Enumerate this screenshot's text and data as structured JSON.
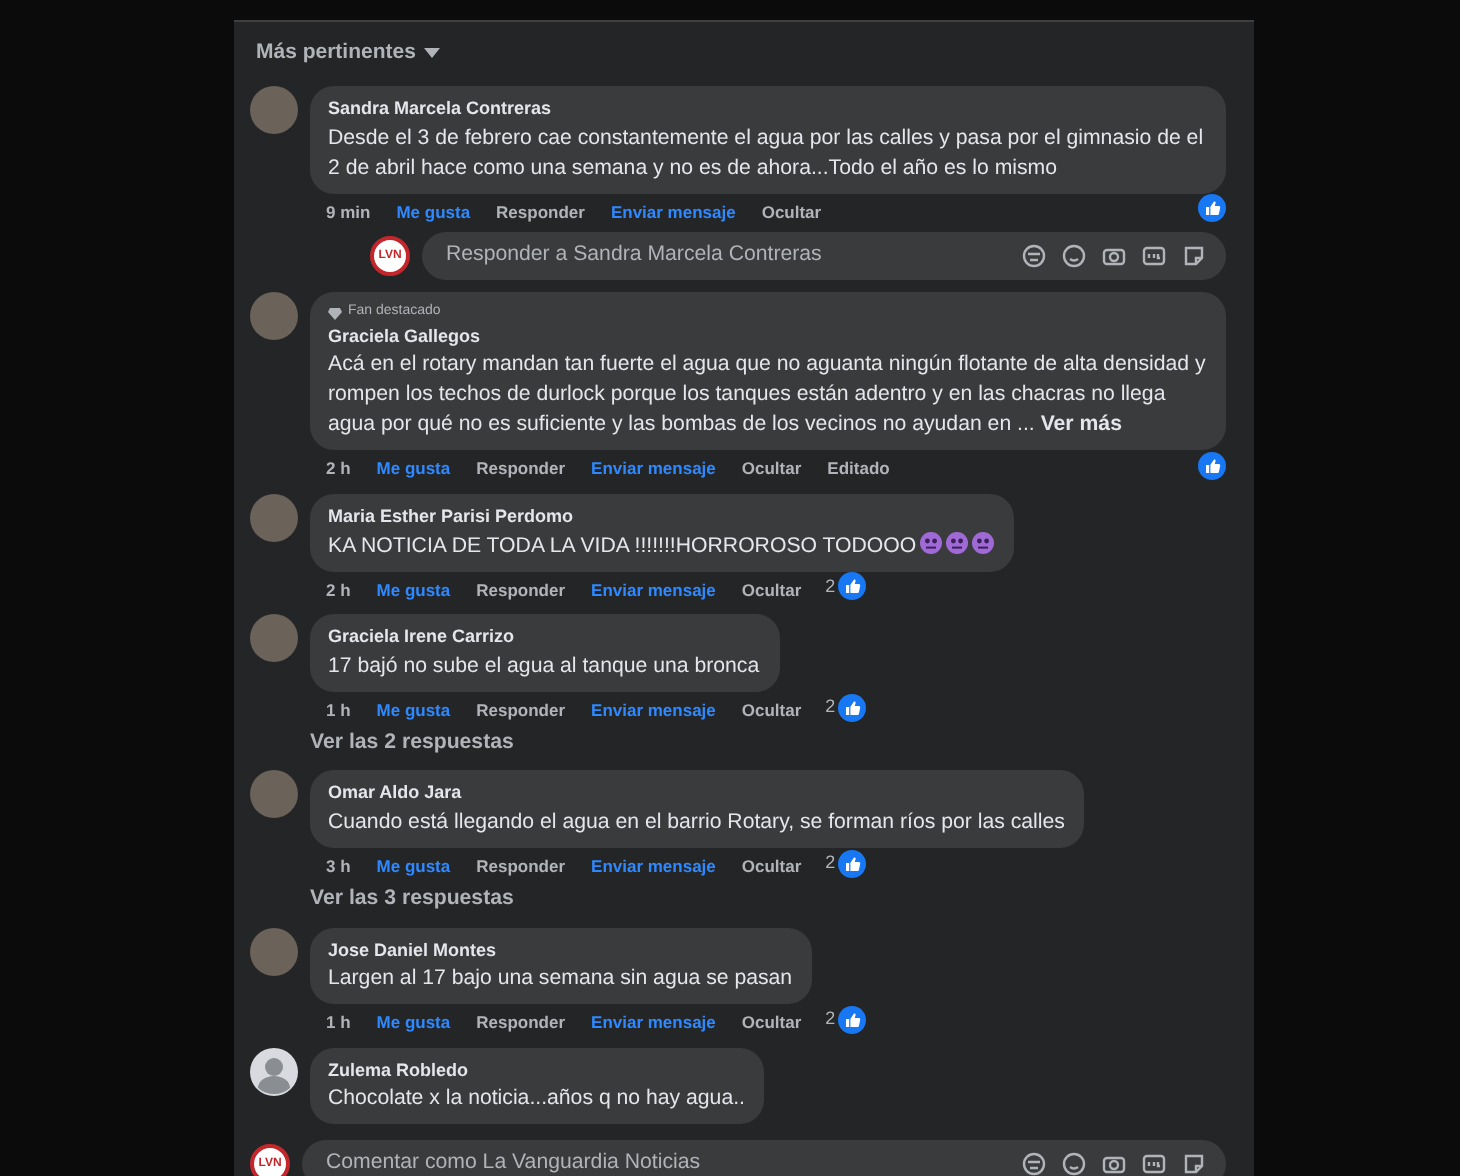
{
  "sort": {
    "label": "Más pertinentes"
  },
  "comments": [
    {
      "author": "Sandra Marcela Contreras",
      "kind": "photo",
      "text": "Desde el 3 de febrero cae constantemente el agua por las calles y pasa por el gimnasio de el 2 de abril hace como una semana y no es de ahora...Todo el año es lo mismo",
      "time": "9 min",
      "actions": [
        "Me gusta",
        "Responder",
        "Enviar mensaje",
        "Ocultar"
      ],
      "reply_box": {
        "avatar_text": "LVN",
        "placeholder": "Responder a Sandra Marcela Contreras"
      }
    },
    {
      "badge": "Fan destacado",
      "author": "Graciela Gallegos",
      "kind": "photo",
      "text": "Acá en el rotary mandan tan fuerte el agua que no aguanta ningún flotante de alta densidad y rompen los techos de durlock porque los tanques están adentro y en las chacras no llega agua por qué no es suficiente y las bombas de los vecinos no ayudan en ...",
      "more": "Ver más",
      "time": "2 h",
      "actions": [
        "Me gusta",
        "Responder",
        "Enviar mensaje",
        "Ocultar"
      ],
      "edited": "Editado"
    },
    {
      "author": "Maria Esther Parisi Perdomo",
      "kind": "photo",
      "text": "KA NOTICIA DE TODA LA VIDA !!!!!!!HORROROSO TODOOO",
      "emojis": [
        {
          "kind": "face"
        },
        {
          "kind": "face"
        },
        {
          "kind": "face"
        }
      ],
      "time": "2 h",
      "actions": [
        "Me gusta",
        "Responder",
        "Enviar mensaje",
        "Ocultar"
      ],
      "reaction_count": "2"
    },
    {
      "author": "Graciela Irene Carrizo",
      "kind": "photo",
      "text": "17 bajó no sube el agua al tanque una bronca",
      "time": "1 h",
      "actions": [
        "Me gusta",
        "Responder",
        "Enviar mensaje",
        "Ocultar"
      ],
      "reaction_count": "2",
      "replies_link": "Ver las 2 respuestas"
    },
    {
      "author": "Omar Aldo Jara",
      "kind": "photo",
      "text": "Cuando está llegando el agua en el barrio Rotary, se forman ríos por las calles",
      "time": "3 h",
      "actions": [
        "Me gusta",
        "Responder",
        "Enviar mensaje",
        "Ocultar"
      ],
      "reaction_count": "2",
      "replies_link": "Ver las 3 respuestas"
    },
    {
      "author": "Jose Daniel Montes",
      "kind": "photo",
      "text": "Largen al 17 bajo una semana sin agua se pasan",
      "time": "1 h",
      "actions": [
        "Me gusta",
        "Responder",
        "Enviar mensaje",
        "Ocultar"
      ],
      "reaction_count": "2"
    },
    {
      "author": "Zulema Robledo",
      "kind": "default",
      "text": "Chocolate x la noticia...años q no hay agua.."
    }
  ],
  "composer": {
    "avatar_text": "LVN",
    "placeholder": "Comentar como La Vanguardia Noticias"
  }
}
